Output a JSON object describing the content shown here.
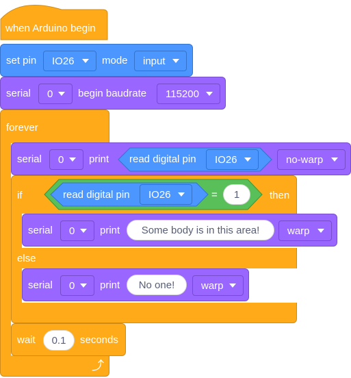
{
  "hat": {
    "label": "when Arduino begin"
  },
  "set_pin": {
    "label": "set pin",
    "pin": "IO26",
    "mode_label": "mode",
    "mode": "input"
  },
  "serial_begin": {
    "label": "serial",
    "port": "0",
    "text": "begin baudrate",
    "baud": "115200"
  },
  "forever": {
    "label": "forever"
  },
  "print_block_1": {
    "serial_label": "serial",
    "port": "0",
    "print_label": "print",
    "reporter_label": "read digital pin",
    "pin": "IO26",
    "warp": "no-warp"
  },
  "if_block": {
    "if_label": "if",
    "reporter_label": "read digital pin",
    "pin": "IO26",
    "equals": "=",
    "value": "1",
    "then_label": "then",
    "else_label": "else"
  },
  "print_block_2": {
    "serial_label": "serial",
    "port": "0",
    "print_label": "print",
    "message": "Some body is in this area!",
    "warp": "warp"
  },
  "print_block_3": {
    "serial_label": "serial",
    "port": "0",
    "print_label": "print",
    "message": "No one!",
    "warp": "warp"
  },
  "wait_block": {
    "label": "wait",
    "value": "0.1",
    "unit": "seconds"
  },
  "icons": {
    "loop": "loop-arrow-icon",
    "dropdown": "caret-down-icon"
  },
  "colors": {
    "events": "#ffab19",
    "control": "#ffab19",
    "pins": "#4c97ff",
    "serial": "#9966ff",
    "operators": "#59c059"
  }
}
